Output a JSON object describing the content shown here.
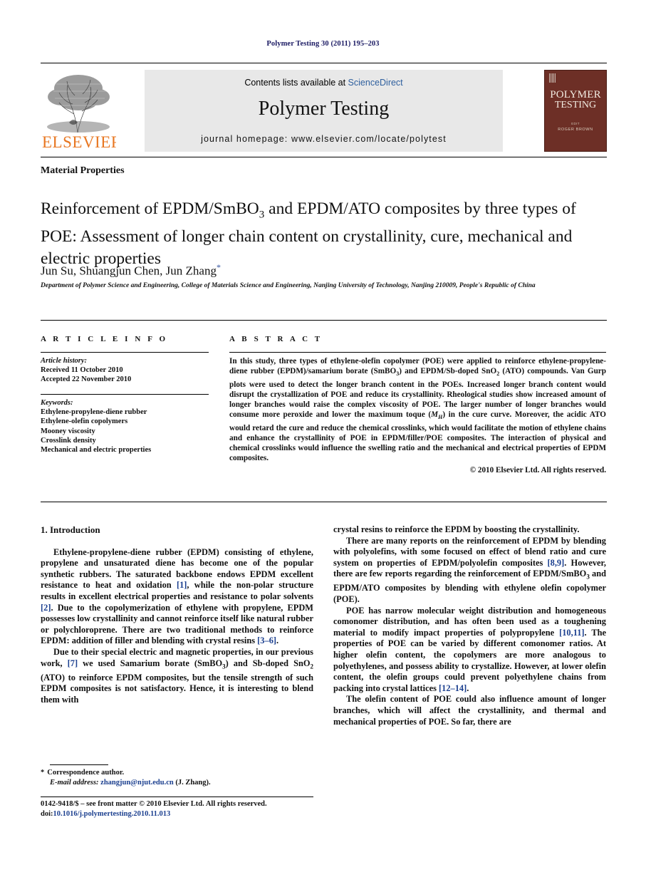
{
  "running_head": "Polymer Testing 30 (2011) 195–203",
  "banner": {
    "contents_prefix": "Contents lists available at ",
    "sciencedirect": "ScienceDirect",
    "journal_title": "Polymer Testing",
    "homepage": "journal homepage: www.elsevier.com/locate/polytest",
    "publisher": "ELSEVIER",
    "cover": {
      "line1": "POLYMER",
      "line2": "TESTING",
      "line3": "EDIT",
      "line4": "ROGER BROWN"
    },
    "link_color": "#2e5f9e",
    "elsevier_color": "#e87722",
    "cover_color": "#6d2f26"
  },
  "section_label": "Material Properties",
  "title": "Reinforcement of EPDM/SmBO3 and EPDM/ATO composites by three types of POE: Assessment of longer chain content on crystallinity, cure, mechanical and electric properties",
  "authors": "Jun Su, Shuangjun Chen, Jun Zhang",
  "author_star": "*",
  "affiliation": "Department of Polymer Science and Engineering, College of Materials Science and Engineering, Nanjing University of Technology, Nanjing 210009, People's Republic of China",
  "article_info": {
    "heading": "A R T I C L E   I N F O",
    "history_label": "Article history:",
    "received": "Received 11 October 2010",
    "accepted": "Accepted 22 November 2010",
    "keywords_label": "Keywords:",
    "keywords": [
      "Ethylene-propylene-diene rubber",
      "Ethylene-olefin copolymers",
      "Mooney viscosity",
      "Crosslink density",
      "Mechanical and electric properties"
    ]
  },
  "abstract": {
    "heading": "A B S T R A C T",
    "text": "In this study, three types of ethylene-olefin copolymer (POE) were applied to reinforce ethylene-propylene-diene rubber (EPDM)/samarium borate (SmBO3) and EPDM/Sb-doped SnO2 (ATO) compounds. Van Gurp plots were used to detect the longer branch content in the POEs. Increased longer branch content would disrupt the crystallization of POE and reduce its crystallinity. Rheological studies show increased amount of longer branches would raise the complex viscosity of POE. The larger number of longer branches would consume more peroxide and lower the maximum toque (MH) in the cure curve. Moreover, the acidic ATO would retard the cure and reduce the chemical crosslinks, which would facilitate the motion of ethylene chains and enhance the crystallinity of POE in EPDM/filler/POE composites. The interaction of physical and chemical crosslinks would influence the swelling ratio and the mechanical and electrical properties of EPDM composites.",
    "copyright": "© 2010 Elsevier Ltd. All rights reserved."
  },
  "body": {
    "intro_heading": "1. Introduction",
    "left_paragraphs": [
      "Ethylene-propylene-diene rubber (EPDM) consisting of ethylene, propylene and unsaturated diene has become one of the popular synthetic rubbers. The saturated backbone endows EPDM excellent resistance to heat and oxidation [1], while the non-polar structure results in excellent electrical properties and resistance to polar solvents [2]. Due to the copolymerization of ethylene with propylene, EPDM possesses low crystallinity and cannot reinforce itself like natural rubber or polychloroprene. There are two traditional methods to reinforce EPDM: addition of filler and blending with crystal resins [3–6].",
      "Due to their special electric and magnetic properties, in our previous work, [7] we used Samarium borate (SmBO3) and Sb-doped SnO2 (ATO) to reinforce EPDM composites, but the tensile strength of such EPDM composites is not satisfactory. Hence, it is interesting to blend them with"
    ],
    "right_paragraphs": [
      "crystal resins to reinforce the EPDM by boosting the crystallinity.",
      "There are many reports on the reinforcement of EPDM by blending with polyolefins, with some focused on effect of blend ratio and cure system on properties of EPDM/polyolefin composites [8,9]. However, there are few reports regarding the reinforcement of EPDM/SmBO3 and EPDM/ATO composites by blending with ethylene olefin copolymer (POE).",
      "POE has narrow molecular weight distribution and homogeneous comonomer distribution, and has often been used as a toughening material to modify impact properties of polypropylene [10,11]. The properties of POE can be varied by different comonomer ratios. At higher olefin content, the copolymers are more analogous to polyethylenes, and possess ability to crystallize. However, at lower olefin content, the olefin groups could prevent polyethylene chains from packing into crystal lattices [12–14].",
      "The olefin content of POE could also influence amount of longer branches, which will affect the crystallinity, and thermal and mechanical properties of POE. So far, there are"
    ]
  },
  "footnote": {
    "star": "*",
    "correspondence": "Correspondence author.",
    "email_label": "E-mail address:",
    "email": "zhangjun@njut.edu.cn",
    "email_suffix": "(J. Zhang)."
  },
  "footer": {
    "issn_line": "0142-9418/$ – see front matter © 2010 Elsevier Ltd. All rights reserved.",
    "doi_label": "doi:",
    "doi": "10.1016/j.polymertesting.2010.11.013"
  }
}
